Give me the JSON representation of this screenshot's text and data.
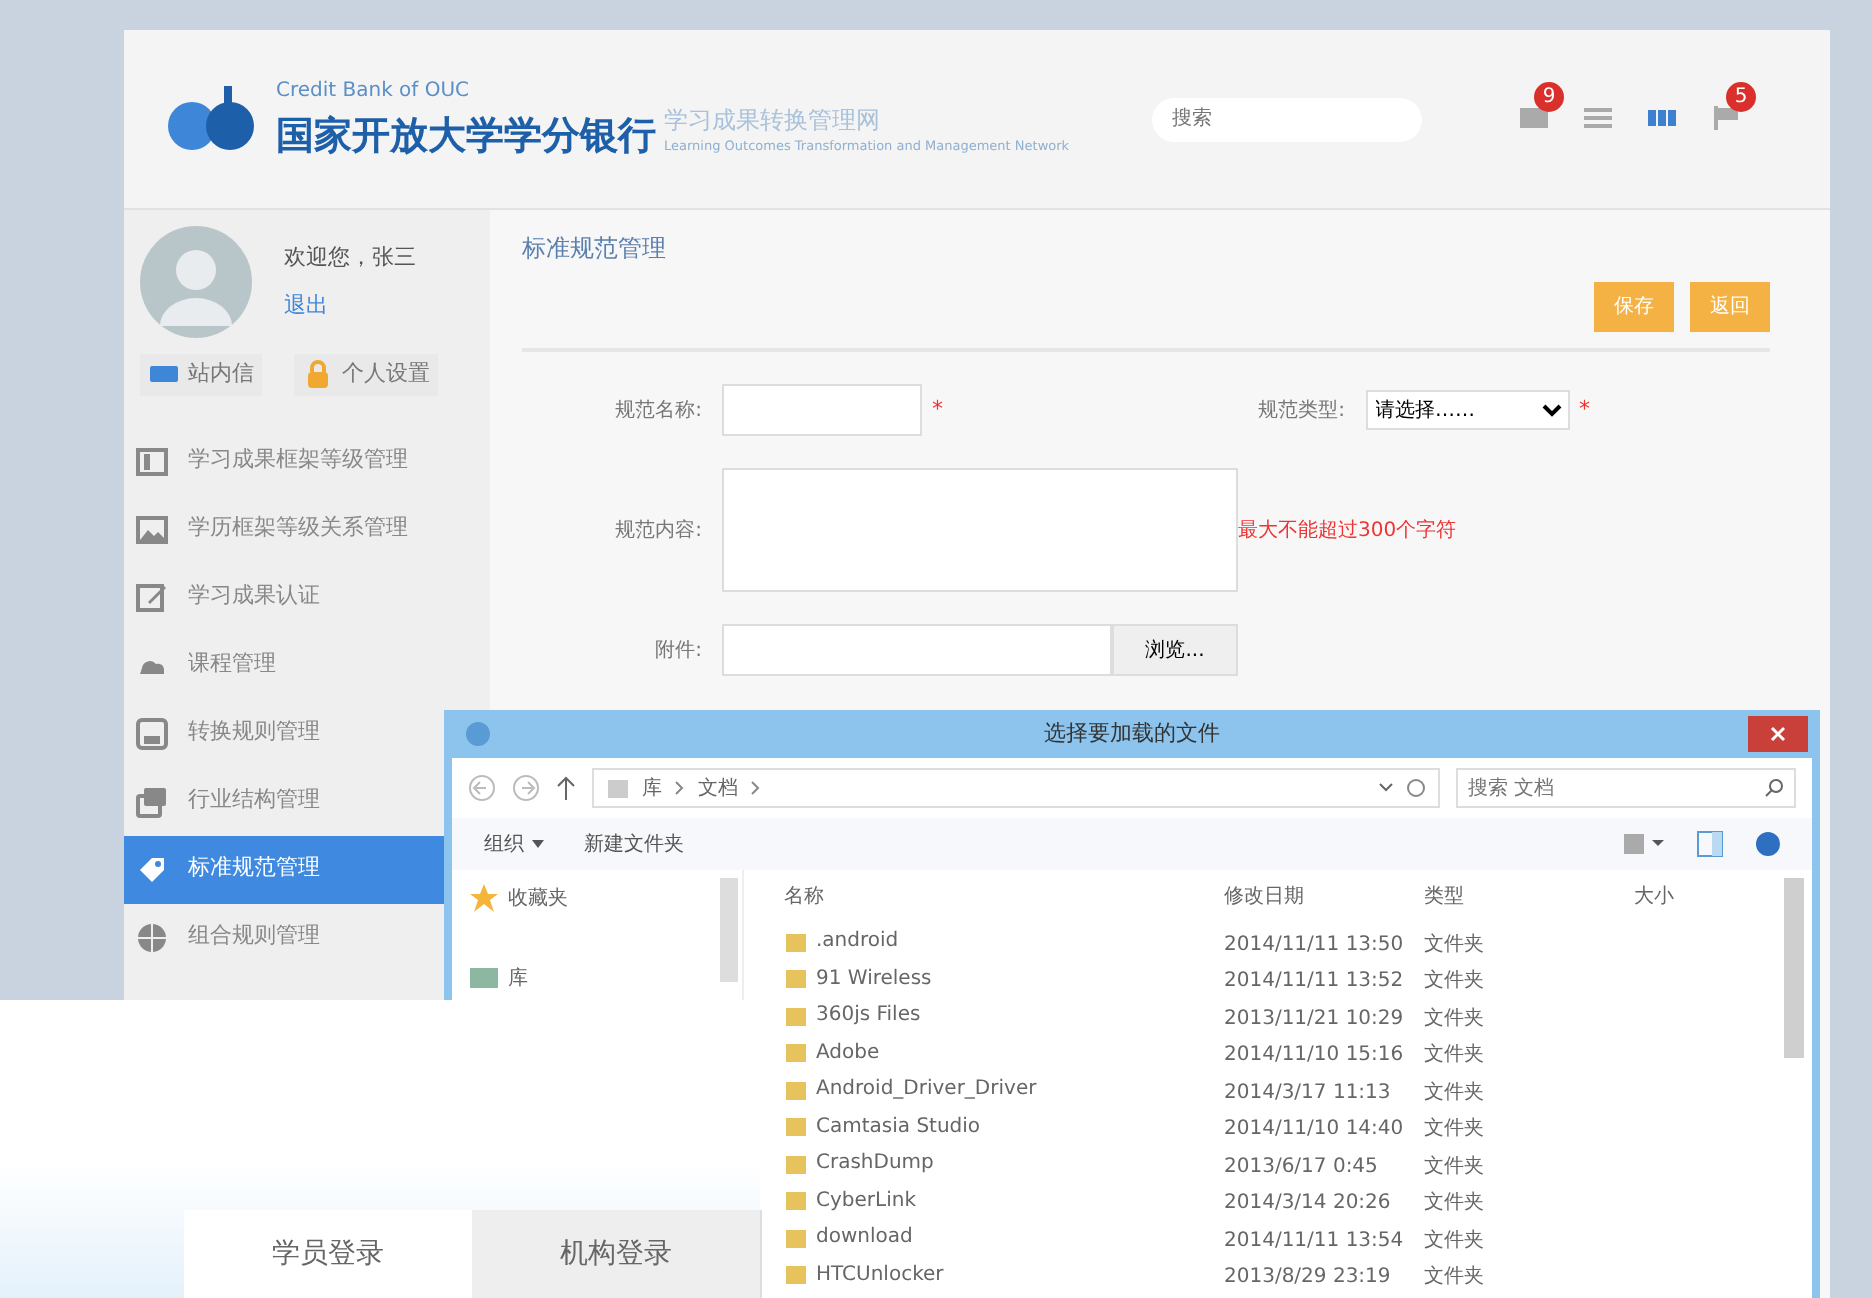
{
  "header": {
    "logo": {
      "org_en": "Credit Bank of OUC",
      "org_cn": "国家开放大学学分银行",
      "site_cn": "学习成果转换管理网",
      "site_en": "Learning Outcomes Transformation and Management Network"
    },
    "search": {
      "placeholder": "搜索"
    },
    "icons": [
      {
        "kind": "inbox",
        "badge": "9"
      },
      {
        "kind": "list"
      },
      {
        "kind": "grid"
      },
      {
        "kind": "flag",
        "badge": "5"
      }
    ]
  },
  "sidebar": {
    "greeting": "欢迎您，张三",
    "logout": "退出",
    "links": [
      {
        "kind": "mail",
        "label": "站内信"
      },
      {
        "kind": "lock",
        "label": "个人设置"
      }
    ],
    "menu": [
      {
        "kind": "book",
        "label": "学习成果框架等级管理",
        "selected": false
      },
      {
        "kind": "image",
        "label": "学历框架等级关系管理",
        "selected": false
      },
      {
        "kind": "edit",
        "label": "学习成果认证",
        "selected": false
      },
      {
        "kind": "cloud",
        "label": "课程管理",
        "selected": false
      },
      {
        "kind": "save",
        "label": "转换规则管理",
        "selected": false
      },
      {
        "kind": "layers",
        "label": "行业结构管理",
        "selected": false
      },
      {
        "kind": "tag",
        "label": "标准规范管理",
        "selected": true
      },
      {
        "kind": "globe",
        "label": "组合规则管理",
        "selected": false
      }
    ]
  },
  "form": {
    "title": "标准规范管理",
    "buttons": [
      "保存",
      "返回"
    ],
    "fields": [
      {
        "kind": "text",
        "label": "规范名称:",
        "required_mark": "*"
      },
      {
        "kind": "select",
        "label": "规范类型:",
        "value": "请选择……",
        "required_mark": "*"
      },
      {
        "kind": "textarea",
        "label": "规范内容:",
        "hint": "最大不能超过300个字符"
      },
      {
        "kind": "file",
        "label": "附件:",
        "button": "浏览..."
      }
    ]
  },
  "dialog": {
    "title": "选择要加载的文件",
    "path": [
      "库",
      "文档"
    ],
    "search": {
      "placeholder": "搜索 文档"
    },
    "toolbar": [
      "组织",
      "新建文件夹"
    ],
    "nav": [
      {
        "kind": "star",
        "label": "收藏夹"
      },
      {
        "kind": "library",
        "label": "库"
      }
    ],
    "columns": [
      "名称",
      "修改日期",
      "类型",
      "大小"
    ],
    "rows": [
      {
        "name": ".android",
        "date": "2014/11/11 13:50",
        "type": "文件夹"
      },
      {
        "name": "91 Wireless",
        "date": "2014/11/11 13:52",
        "type": "文件夹"
      },
      {
        "name": "360js Files",
        "date": "2013/11/21 10:29",
        "type": "文件夹"
      },
      {
        "name": "Adobe",
        "date": "2014/11/10 15:16",
        "type": "文件夹"
      },
      {
        "name": "Android_Driver_Driver",
        "date": "2014/3/17 11:13",
        "type": "文件夹"
      },
      {
        "name": "Camtasia Studio",
        "date": "2014/11/10 14:40",
        "type": "文件夹"
      },
      {
        "name": "CrashDump",
        "date": "2013/6/17 0:45",
        "type": "文件夹"
      },
      {
        "name": "CyberLink",
        "date": "2014/3/14 20:26",
        "type": "文件夹"
      },
      {
        "name": "download",
        "date": "2014/11/11 13:54",
        "type": "文件夹"
      },
      {
        "name": "HTCUnlocker",
        "date": "2013/8/29 23:19",
        "type": "文件夹"
      }
    ]
  },
  "login_tabs": [
    {
      "label": "学员登录",
      "selected": true
    },
    {
      "label": "机构登录",
      "selected": false
    }
  ]
}
